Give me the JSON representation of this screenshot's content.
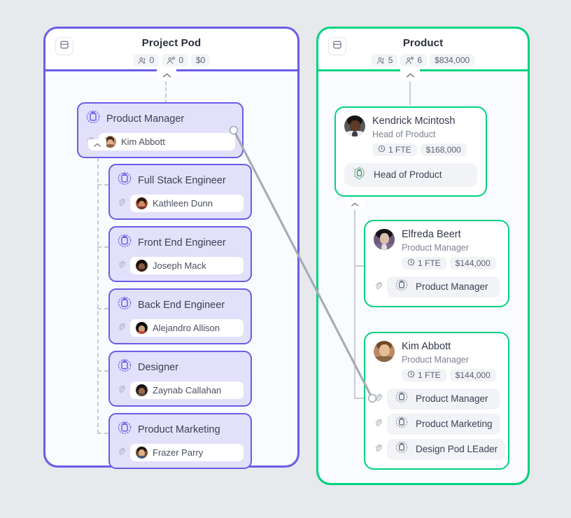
{
  "page": {
    "background": "#e8e9ec",
    "accent_purple": "#6c5ce7",
    "accent_green": "#00d37f"
  },
  "panels": [
    {
      "id": "project-pod",
      "title": "Project Pod",
      "color": "#6c5ce7",
      "panel_icon": "panel-layout-icon",
      "stats": [
        {
          "icon": "people-icon",
          "value": "0"
        },
        {
          "icon": "person-gear-icon",
          "value": "0"
        },
        {
          "icon": "money-icon",
          "value": "$0"
        }
      ]
    },
    {
      "id": "product",
      "title": "Product",
      "color": "#00d37f",
      "panel_icon": "panel-layout-icon",
      "stats": [
        {
          "icon": "people-icon",
          "value": "5"
        },
        {
          "icon": "person-gear-icon",
          "value": "6"
        },
        {
          "icon": "money-icon",
          "value": "$834,000"
        }
      ]
    }
  ],
  "role_cards": [
    {
      "title": "Product Manager",
      "icon": "role-dashed-icon",
      "assignee": "Kim Abbott",
      "avatar": "kim-abbott-avatar",
      "attachment_icon": "paperclip-icon",
      "has_connector_handle": true
    },
    {
      "title": "Full Stack Engineer",
      "icon": "role-dashed-icon",
      "assignee": "Kathleen Dunn",
      "avatar": "kathleen-dunn-avatar",
      "attachment_icon": "paperclip-icon",
      "has_connector_handle": false
    },
    {
      "title": "Front End Engineer",
      "icon": "role-dashed-icon",
      "assignee": "Joseph Mack",
      "avatar": "joseph-mack-avatar",
      "attachment_icon": "paperclip-icon",
      "has_connector_handle": false
    },
    {
      "title": "Back End Engineer",
      "icon": "role-dashed-icon",
      "assignee": "Alejandro Allison",
      "avatar": "alejandro-allison-avatar",
      "attachment_icon": "paperclip-icon",
      "has_connector_handle": false
    },
    {
      "title": "Designer",
      "icon": "role-dashed-icon",
      "assignee": "Zaynab Callahan",
      "avatar": "zaynab-callahan-avatar",
      "attachment_icon": "paperclip-icon",
      "has_connector_handle": false
    },
    {
      "title": "Product Marketing",
      "icon": "role-dashed-icon",
      "assignee": "Frazer Parry",
      "avatar": "frazer-parry-avatar",
      "attachment_icon": "paperclip-icon",
      "has_connector_handle": false
    }
  ],
  "person_cards": [
    {
      "name": "Kendrick Mcintosh",
      "role": "Head of Product",
      "avatar": "kendrick-mcintosh-avatar",
      "fte": "1 FTE",
      "fte_icon": "clock-icon",
      "salary": "$168,000",
      "roles": [
        {
          "label": "Head of Product",
          "icon": "role-hex-icon",
          "attachment": false
        }
      ]
    },
    {
      "name": "Elfreda Beert",
      "role": "Product Manager",
      "avatar": "elfreda-beert-avatar",
      "fte": "1 FTE",
      "fte_icon": "clock-icon",
      "salary": "$144,000",
      "roles": [
        {
          "label": "Product Manager",
          "icon": "role-dashed-icon",
          "attachment": true
        }
      ]
    },
    {
      "name": "Kim Abbott",
      "role": "Product Manager",
      "avatar": "kim-abbott-avatar",
      "fte": "1 FTE",
      "fte_icon": "clock-icon",
      "salary": "$144,000",
      "roles": [
        {
          "label": "Product Manager",
          "icon": "role-dashed-icon",
          "attachment": true
        },
        {
          "label": "Product Marketing",
          "icon": "role-dashed-icon",
          "attachment": true
        },
        {
          "label": "Design Pod LEader",
          "icon": "role-dashed-icon",
          "attachment": true
        }
      ]
    }
  ],
  "connector": {
    "name": "cross-panel-link",
    "from": "project-pod-product-manager-card",
    "to": "kim-abbott-product-manager-chip",
    "color": "#a7adb6"
  }
}
